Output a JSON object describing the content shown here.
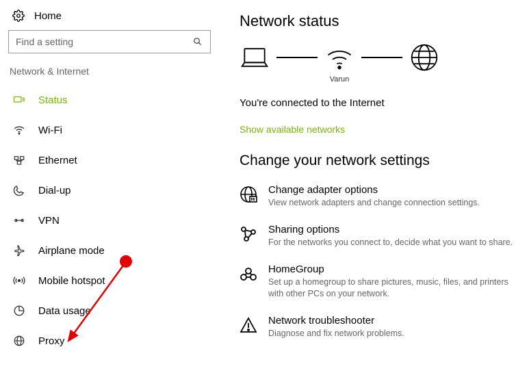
{
  "home_label": "Home",
  "search": {
    "placeholder": "Find a setting"
  },
  "section_label": "Network & Internet",
  "nav": [
    {
      "id": "status",
      "label": "Status",
      "active": true
    },
    {
      "id": "wifi",
      "label": "Wi-Fi"
    },
    {
      "id": "ethernet",
      "label": "Ethernet"
    },
    {
      "id": "dialup",
      "label": "Dial-up"
    },
    {
      "id": "vpn",
      "label": "VPN"
    },
    {
      "id": "airplane",
      "label": "Airplane mode"
    },
    {
      "id": "hotspot",
      "label": "Mobile hotspot"
    },
    {
      "id": "datausage",
      "label": "Data usage"
    },
    {
      "id": "proxy",
      "label": "Proxy"
    }
  ],
  "page_title": "Network status",
  "diagram": {
    "wifi_label": "Varun"
  },
  "status_text": "You're connected to the Internet",
  "available_link": "Show available networks",
  "subheading": "Change your network settings",
  "options": [
    {
      "id": "adapter",
      "title": "Change adapter options",
      "desc": "View network adapters and change connection settings."
    },
    {
      "id": "sharing",
      "title": "Sharing options",
      "desc": "For the networks you connect to, decide what you want to share."
    },
    {
      "id": "homegroup",
      "title": "HomeGroup",
      "desc": "Set up a homegroup to share pictures, music, files, and printers with other PCs on your network."
    },
    {
      "id": "trouble",
      "title": "Network troubleshooter",
      "desc": "Diagnose and fix network problems."
    }
  ]
}
